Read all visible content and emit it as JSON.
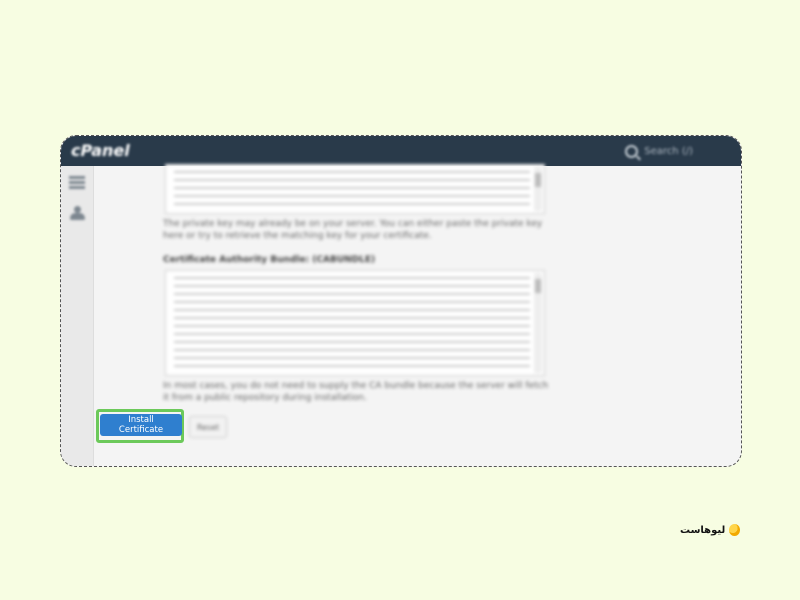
{
  "app": {
    "logo_text": "cPanel",
    "search_placeholder": "Search (/)"
  },
  "sidebar": {
    "icons": [
      "grid-icon",
      "users-icon"
    ]
  },
  "form": {
    "private_key_help": "The private key may already be on your server. You can either paste the private key here or try to retrieve the matching key for your certificate.",
    "cabundle_label": "Certificate Authority Bundle: (CABUNDLE)",
    "cabundle_help": "In most cases, you do not need to supply the CA bundle because the server will fetch it from a public repository during installation.",
    "install_button": "Install Certificate",
    "reset_button": "Reset"
  },
  "brand": {
    "name": "لیوهاست"
  },
  "colors": {
    "page_bg": "#f7fde2",
    "topbar": "#293a4a",
    "primary": "#2f7fcf",
    "highlight": "#6cc95a"
  }
}
